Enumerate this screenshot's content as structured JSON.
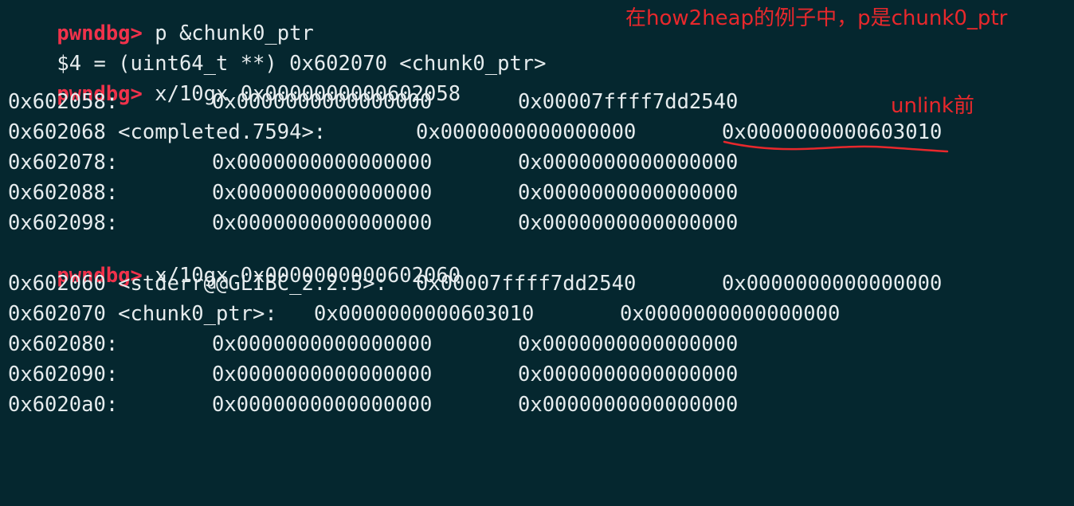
{
  "terminal": {
    "prompt": "pwndbg>",
    "cmd1": "p &chunk0_ptr",
    "result1": "$4 = (uint64_t **) 0x602070 <chunk0_ptr>",
    "cmd2": "x/10gx 0x0000000000602058",
    "dump1": [
      {
        "addr": "0x602058:",
        "v1": "0x0000000000000000",
        "v2": "0x00007ffff7dd2540"
      },
      {
        "addr": "0x602068 <completed.7594>:",
        "v1": "0x0000000000000000",
        "v2": "0x0000000000603010"
      },
      {
        "addr": "0x602078:",
        "v1": "0x0000000000000000",
        "v2": "0x0000000000000000"
      },
      {
        "addr": "0x602088:",
        "v1": "0x0000000000000000",
        "v2": "0x0000000000000000"
      },
      {
        "addr": "0x602098:",
        "v1": "0x0000000000000000",
        "v2": "0x0000000000000000"
      }
    ],
    "cmd3": "x/10gx 0x0000000000602060",
    "dump2": [
      {
        "addr": "0x602060 <stderr@@GLIBC_2.2.5>:",
        "v1": "0x00007ffff7dd2540",
        "v2": "0x0000000000000000"
      },
      {
        "addr": "0x602070 <chunk0_ptr>:",
        "v1": "0x0000000000603010",
        "v2": "0x0000000000000000"
      },
      {
        "addr": "0x602080:",
        "v1": "0x0000000000000000",
        "v2": "0x0000000000000000"
      },
      {
        "addr": "0x602090:",
        "v1": "0x0000000000000000",
        "v2": "0x0000000000000000"
      },
      {
        "addr": "0x6020a0:",
        "v1": "0x0000000000000000",
        "v2": "0x0000000000000000"
      }
    ]
  },
  "annotations": {
    "note1": "在how2heap的例子中，p是chunk0_ptr",
    "note2": "unlink前"
  },
  "colors": {
    "background": "#05272f",
    "prompt": "#f0324b",
    "text": "#e6ecee",
    "annotation": "#e8282c"
  }
}
